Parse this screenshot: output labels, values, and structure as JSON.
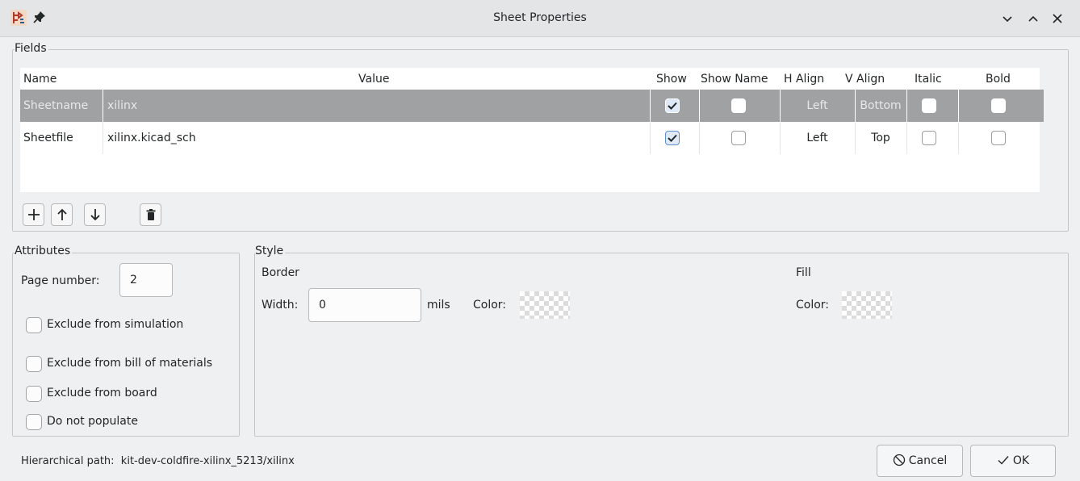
{
  "window": {
    "title": "Sheet Properties",
    "icons": [
      "kicad-app-icon",
      "pin-icon",
      "minimize-icon",
      "maximize-icon",
      "close-icon"
    ]
  },
  "fields": {
    "group_label": "Fields",
    "columns": [
      "Name",
      "Value",
      "Show",
      "Show Name",
      "H Align",
      "V Align",
      "Italic",
      "Bold"
    ],
    "rows": [
      {
        "name": "Sheetname",
        "value": "xilinx",
        "show": true,
        "show_name": false,
        "h_align": "Left",
        "v_align": "Bottom",
        "italic": false,
        "bold": false,
        "selected": true
      },
      {
        "name": "Sheetfile",
        "value": "xilinx.kicad_sch",
        "show": true,
        "show_name": false,
        "h_align": "Left",
        "v_align": "Top",
        "italic": false,
        "bold": false,
        "selected": false
      }
    ],
    "toolbar": [
      "add-icon",
      "move-up-icon",
      "move-down-icon",
      "delete-icon"
    ]
  },
  "attributes": {
    "group_label": "Attributes",
    "page_number_label": "Page number:",
    "page_number_value": "2",
    "options": [
      {
        "label": "Exclude from simulation",
        "checked": false
      },
      {
        "label": "Exclude from bill of materials",
        "checked": false
      },
      {
        "label": "Exclude from board",
        "checked": false
      },
      {
        "label": "Do not populate",
        "checked": false
      }
    ]
  },
  "style": {
    "group_label": "Style",
    "border": {
      "label": "Border",
      "width_label": "Width:",
      "width_value": "0",
      "units": "mils",
      "color_label": "Color:"
    },
    "fill": {
      "label": "Fill",
      "color_label": "Color:"
    }
  },
  "footer": {
    "hierarchical_path": "Hierarchical path:  kit-dev-coldfire-xilinx_5213/xilinx",
    "cancel_label": "Cancel",
    "ok_label": "OK"
  },
  "colors": {
    "window_bg": "#eff0f1",
    "selected_row": "#a0a1a2",
    "checkbox_accent": "#5d8fd0"
  }
}
